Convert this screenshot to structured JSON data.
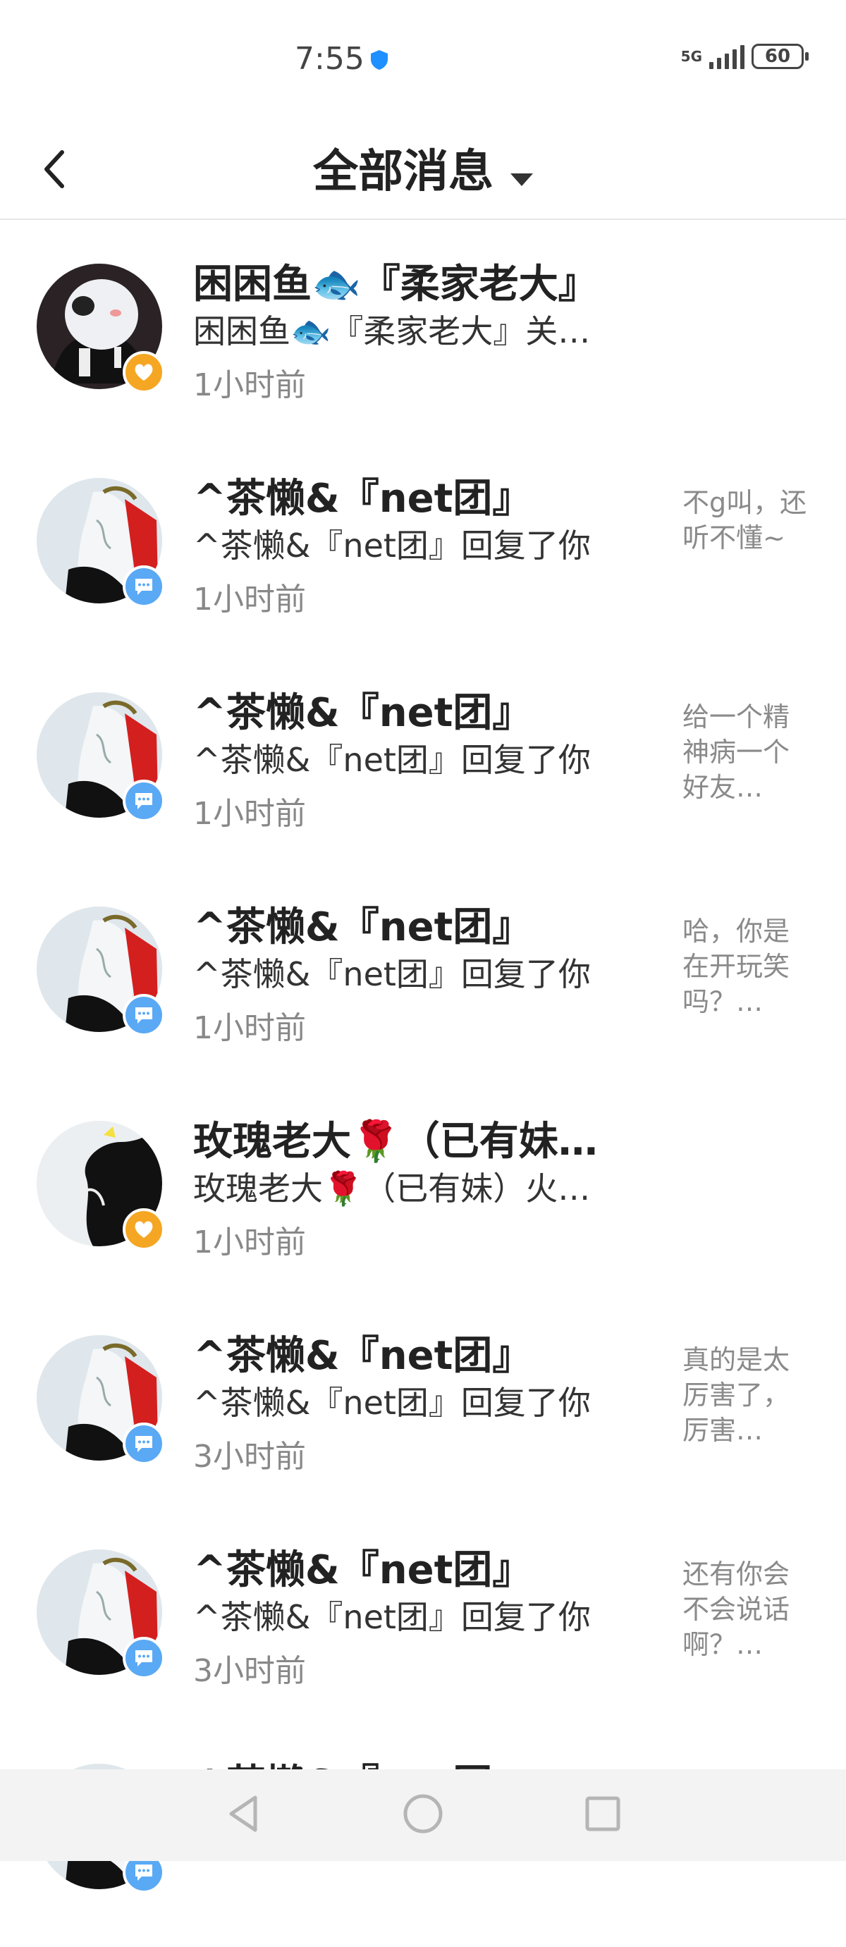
{
  "status": {
    "time": "7:55",
    "network": "5G",
    "battery": "60"
  },
  "header": {
    "title": "全部消息"
  },
  "messages": [
    {
      "avatar": "avatar-panda",
      "badge": "heart",
      "name": "困困鱼🐟『柔家老大』",
      "desc": "困困鱼🐟『柔家老大』关…",
      "time": "1小时前",
      "preview": ""
    },
    {
      "avatar": "avatar-anime",
      "badge": "comment",
      "name": "^茶懒&『net团』",
      "desc": "^茶懒&『net团』回复了你",
      "time": "1小时前",
      "preview": "不g叫，还听不懂~"
    },
    {
      "avatar": "avatar-anime",
      "badge": "comment",
      "name": "^茶懒&『net团』",
      "desc": "^茶懒&『net团』回复了你",
      "time": "1小时前",
      "preview": "给一个精神病一个好友…"
    },
    {
      "avatar": "avatar-anime",
      "badge": "comment",
      "name": "^茶懒&『net团』",
      "desc": "^茶懒&『net团』回复了你",
      "time": "1小时前",
      "preview": "哈，你是在开玩笑吗？…"
    },
    {
      "avatar": "avatar-silhouette",
      "badge": "heart",
      "name": "玫瑰老大🌹（已有妹…",
      "desc": "玫瑰老大🌹（已有妹）火…",
      "time": "1小时前",
      "preview": ""
    },
    {
      "avatar": "avatar-anime",
      "badge": "comment",
      "name": "^茶懒&『net团』",
      "desc": "^茶懒&『net团』回复了你",
      "time": "3小时前",
      "preview": "真的是太厉害了，厉害…"
    },
    {
      "avatar": "avatar-anime",
      "badge": "comment",
      "name": "^茶懒&『net团』",
      "desc": "^茶懒&『net团』回复了你",
      "time": "3小时前",
      "preview": "还有你会不会说话啊？…"
    },
    {
      "avatar": "avatar-anime",
      "badge": "comment",
      "name": "^茶懒&『net团』",
      "desc": "",
      "time": "",
      "preview": ""
    }
  ],
  "navbar": {
    "buttons": [
      "back-nav-icon",
      "home-nav-icon",
      "recents-nav-icon"
    ]
  },
  "colors": {
    "heart_badge": "#f5a623",
    "comment_badge": "#5aa9f5",
    "time_gray": "#888888"
  }
}
